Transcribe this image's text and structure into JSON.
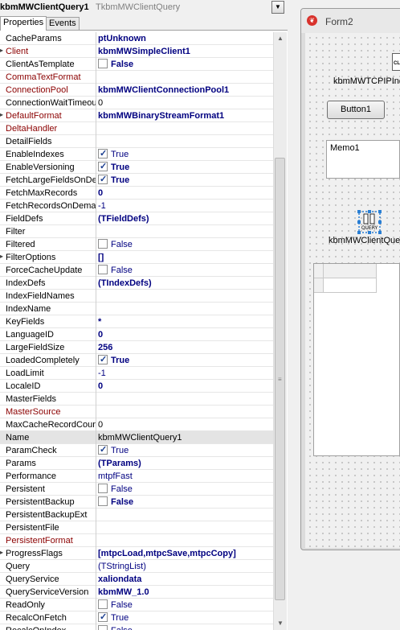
{
  "inspector": {
    "component_name": "kbmMWClientQuery1",
    "component_class": "TkbmMWClientQuery",
    "tabs": [
      "Properties",
      "Events"
    ],
    "properties": [
      {
        "name": "CacheParams",
        "kind": "text",
        "value": "ptUnknown",
        "bold": true
      },
      {
        "name": "Client",
        "kind": "text",
        "value": "kbmMWSimpleClient1",
        "bold": true,
        "ref": true,
        "expand": true
      },
      {
        "name": "ClientAsTemplate",
        "kind": "check",
        "checked": false,
        "value": "False",
        "bold": true
      },
      {
        "name": "CommaTextFormat",
        "kind": "text",
        "value": "",
        "ref": true
      },
      {
        "name": "ConnectionPool",
        "kind": "text",
        "value": "kbmMWClientConnectionPool1",
        "bold": true,
        "ref": true
      },
      {
        "name": "ConnectionWaitTimeout",
        "kind": "text",
        "value": "0",
        "plain": true
      },
      {
        "name": "DefaultFormat",
        "kind": "text",
        "value": "kbmMWBinaryStreamFormat1",
        "bold": true,
        "ref": true,
        "expand": true
      },
      {
        "name": "DeltaHandler",
        "kind": "text",
        "value": "",
        "ref": true
      },
      {
        "name": "DetailFields",
        "kind": "text",
        "value": ""
      },
      {
        "name": "EnableIndexes",
        "kind": "check",
        "checked": true,
        "value": "True",
        "bold": false
      },
      {
        "name": "EnableVersioning",
        "kind": "check",
        "checked": true,
        "value": "True",
        "bold": true
      },
      {
        "name": "FetchLargeFieldsOnDemand",
        "kind": "check",
        "checked": true,
        "value": "True",
        "bold": true
      },
      {
        "name": "FetchMaxRecords",
        "kind": "text",
        "value": "0",
        "bold": true
      },
      {
        "name": "FetchRecordsOnDemand",
        "kind": "text",
        "value": "-1",
        "bold": false
      },
      {
        "name": "FieldDefs",
        "kind": "text",
        "value": "(TFieldDefs)",
        "bold": true
      },
      {
        "name": "Filter",
        "kind": "text",
        "value": ""
      },
      {
        "name": "Filtered",
        "kind": "check",
        "checked": false,
        "value": "False",
        "bold": false
      },
      {
        "name": "FilterOptions",
        "kind": "text",
        "value": "[]",
        "bold": true,
        "expand": true
      },
      {
        "name": "ForceCacheUpdate",
        "kind": "check",
        "checked": false,
        "value": "False",
        "bold": false
      },
      {
        "name": "IndexDefs",
        "kind": "text",
        "value": "(TIndexDefs)",
        "bold": true
      },
      {
        "name": "IndexFieldNames",
        "kind": "text",
        "value": ""
      },
      {
        "name": "IndexName",
        "kind": "text",
        "value": ""
      },
      {
        "name": "KeyFields",
        "kind": "text",
        "value": "*",
        "bold": true
      },
      {
        "name": "LanguageID",
        "kind": "text",
        "value": "0",
        "bold": true
      },
      {
        "name": "LargeFieldSize",
        "kind": "text",
        "value": "256",
        "bold": true
      },
      {
        "name": "LoadedCompletely",
        "kind": "check",
        "checked": true,
        "value": "True",
        "bold": true
      },
      {
        "name": "LoadLimit",
        "kind": "text",
        "value": "-1",
        "bold": false
      },
      {
        "name": "LocaleID",
        "kind": "text",
        "value": "0",
        "bold": true
      },
      {
        "name": "MasterFields",
        "kind": "text",
        "value": ""
      },
      {
        "name": "MasterSource",
        "kind": "text",
        "value": "",
        "ref": true
      },
      {
        "name": "MaxCacheRecordCount",
        "kind": "text",
        "value": "0",
        "plain": true
      },
      {
        "name": "Name",
        "kind": "text",
        "value": "kbmMWClientQuery1",
        "plain": true,
        "selected": true
      },
      {
        "name": "ParamCheck",
        "kind": "check",
        "checked": true,
        "value": "True",
        "bold": false
      },
      {
        "name": "Params",
        "kind": "text",
        "value": "(TParams)",
        "bold": true
      },
      {
        "name": "Performance",
        "kind": "text",
        "value": "mtpfFast",
        "bold": false
      },
      {
        "name": "Persistent",
        "kind": "check",
        "checked": false,
        "value": "False",
        "bold": false
      },
      {
        "name": "PersistentBackup",
        "kind": "check",
        "checked": false,
        "value": "False",
        "bold": true
      },
      {
        "name": "PersistentBackupExt",
        "kind": "text",
        "value": ""
      },
      {
        "name": "PersistentFile",
        "kind": "text",
        "value": ""
      },
      {
        "name": "PersistentFormat",
        "kind": "text",
        "value": "",
        "ref": true
      },
      {
        "name": "ProgressFlags",
        "kind": "text",
        "value": "[mtpcLoad,mtpcSave,mtpcCopy]",
        "bold": true,
        "expand": true
      },
      {
        "name": "Query",
        "kind": "text",
        "value": "(TStringList)",
        "bold": false
      },
      {
        "name": "QueryService",
        "kind": "text",
        "value": "xaliondata",
        "bold": true
      },
      {
        "name": "QueryServiceVersion",
        "kind": "text",
        "value": "kbmMW_1.0",
        "bold": true
      },
      {
        "name": "ReadOnly",
        "kind": "check",
        "checked": false,
        "value": "False",
        "bold": false
      },
      {
        "name": "RecalcOnFetch",
        "kind": "check",
        "checked": true,
        "value": "True",
        "bold": false
      },
      {
        "name": "RecalcOnIndex",
        "kind": "check",
        "checked": false,
        "value": "False",
        "bold": false
      }
    ]
  },
  "designer": {
    "form_caption": "Form2",
    "tcp_label": "kbmMWTCPIPInd",
    "button_label": "Button1",
    "memo_text": "Memo1",
    "query_icon_text": "QUERY",
    "query_label": "kbmMWClientQuer"
  },
  "colors": {
    "value_text": "#000080",
    "reference_property": "#8b0000",
    "checkbox_tick": "#1a3d8f",
    "selected_row": "#e4e4e4",
    "form_icon": "#d8322c"
  }
}
